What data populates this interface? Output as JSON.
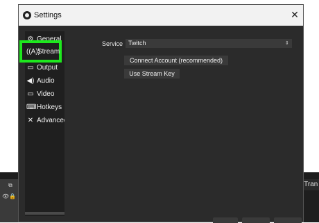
{
  "background_app": {
    "panel_text": "e Tran"
  },
  "dialog": {
    "title": "Settings",
    "close_label": "✕"
  },
  "sidebar": {
    "items": [
      {
        "label": "General",
        "icon": "gear-icon"
      },
      {
        "label": "Stream",
        "icon": "broadcast-icon"
      },
      {
        "label": "Output",
        "icon": "output-icon"
      },
      {
        "label": "Audio",
        "icon": "speaker-icon"
      },
      {
        "label": "Video",
        "icon": "monitor-icon"
      },
      {
        "label": "Hotkeys",
        "icon": "keyboard-icon"
      },
      {
        "label": "Advanced",
        "icon": "wrench-icon"
      }
    ],
    "selected": "Stream"
  },
  "stream": {
    "service_label": "Service",
    "service_value": "Twitch",
    "connect_button": "Connect Account (recommended)",
    "stream_key_button": "Use Stream Key"
  },
  "colors": {
    "highlight": "#1ee81e",
    "dialog_bg": "#2b2b2b",
    "sidebar_bg": "#1f1f1f",
    "button_bg": "#3a3a3a"
  }
}
